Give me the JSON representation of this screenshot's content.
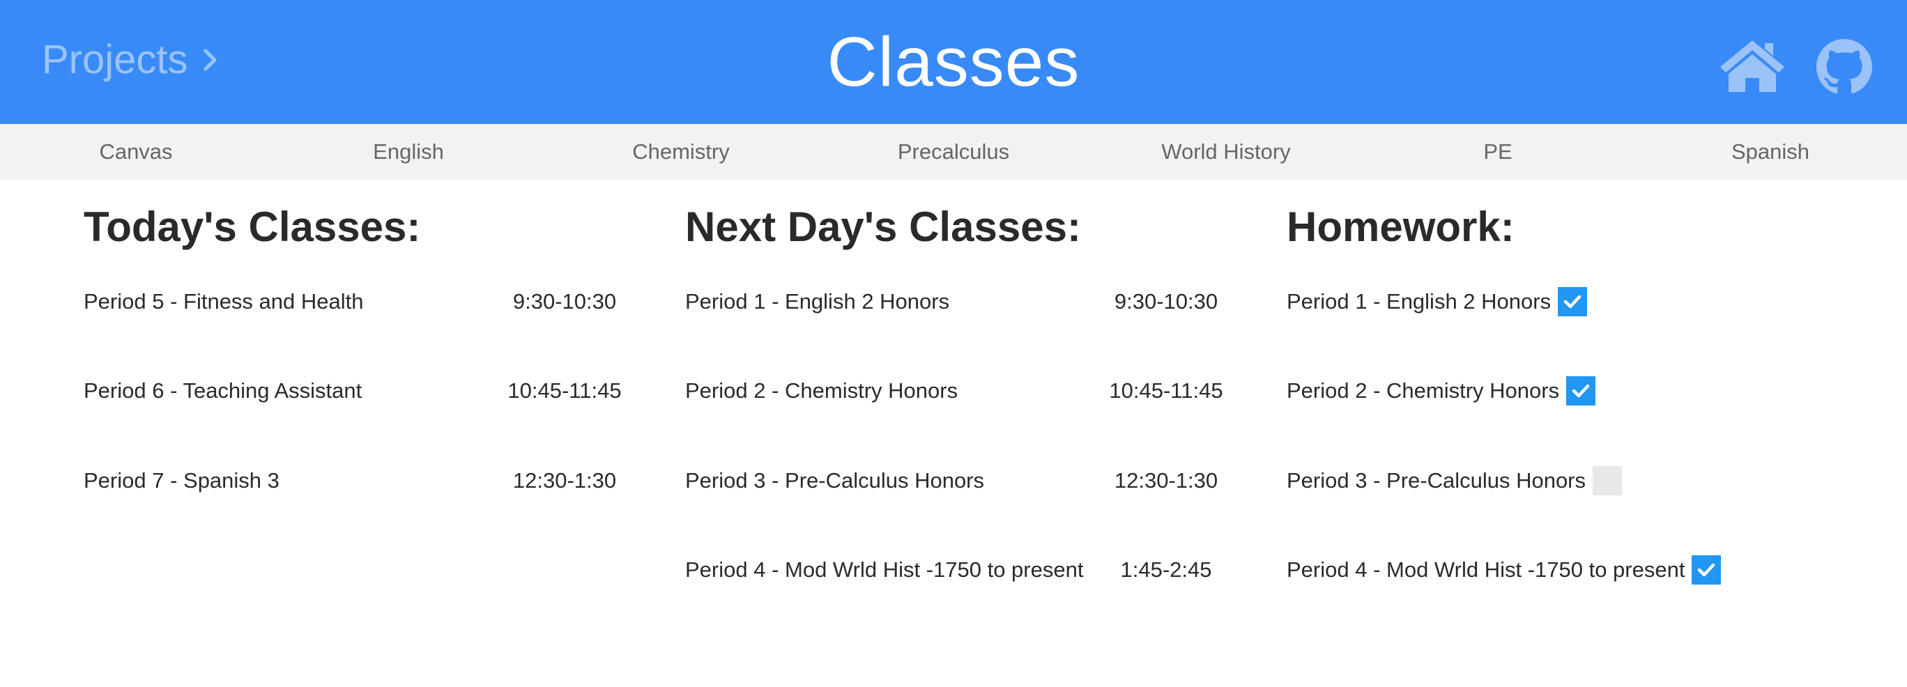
{
  "header": {
    "projects_label": "Projects",
    "title": "Classes",
    "brand_color": "#388bf7",
    "home_icon": "home-icon",
    "github_icon": "github-icon"
  },
  "nav": {
    "items": [
      "Canvas",
      "English",
      "Chemistry",
      "Precalculus",
      "World History",
      "PE",
      "Spanish"
    ]
  },
  "today": {
    "heading": "Today's Classes:",
    "rows": [
      {
        "name": "Period 5 - Fitness and Health",
        "time": "9:30-10:30"
      },
      {
        "name": "Period 6 - Teaching Assistant",
        "time": "10:45-11:45"
      },
      {
        "name": "Period 7 - Spanish 3",
        "time": "12:30-1:30"
      }
    ]
  },
  "next": {
    "heading": "Next Day's Classes:",
    "rows": [
      {
        "name": "Period 1 - English 2 Honors",
        "time": "9:30-10:30"
      },
      {
        "name": "Period 2 - Chemistry Honors",
        "time": "10:45-11:45"
      },
      {
        "name": "Period 3 - Pre-Calculus Honors",
        "time": "12:30-1:30"
      },
      {
        "name": "Period 4 - Mod Wrld Hist -1750 to present",
        "time": "1:45-2:45"
      }
    ]
  },
  "homework": {
    "heading": "Homework:",
    "checkbox_color": "#2196f3",
    "rows": [
      {
        "name": "Period 1 - English 2 Honors",
        "checked": true
      },
      {
        "name": "Period 2 - Chemistry Honors",
        "checked": true
      },
      {
        "name": "Period 3 - Pre-Calculus Honors",
        "checked": false
      },
      {
        "name": "Period 4 - Mod Wrld Hist -1750 to present",
        "checked": true
      }
    ]
  }
}
